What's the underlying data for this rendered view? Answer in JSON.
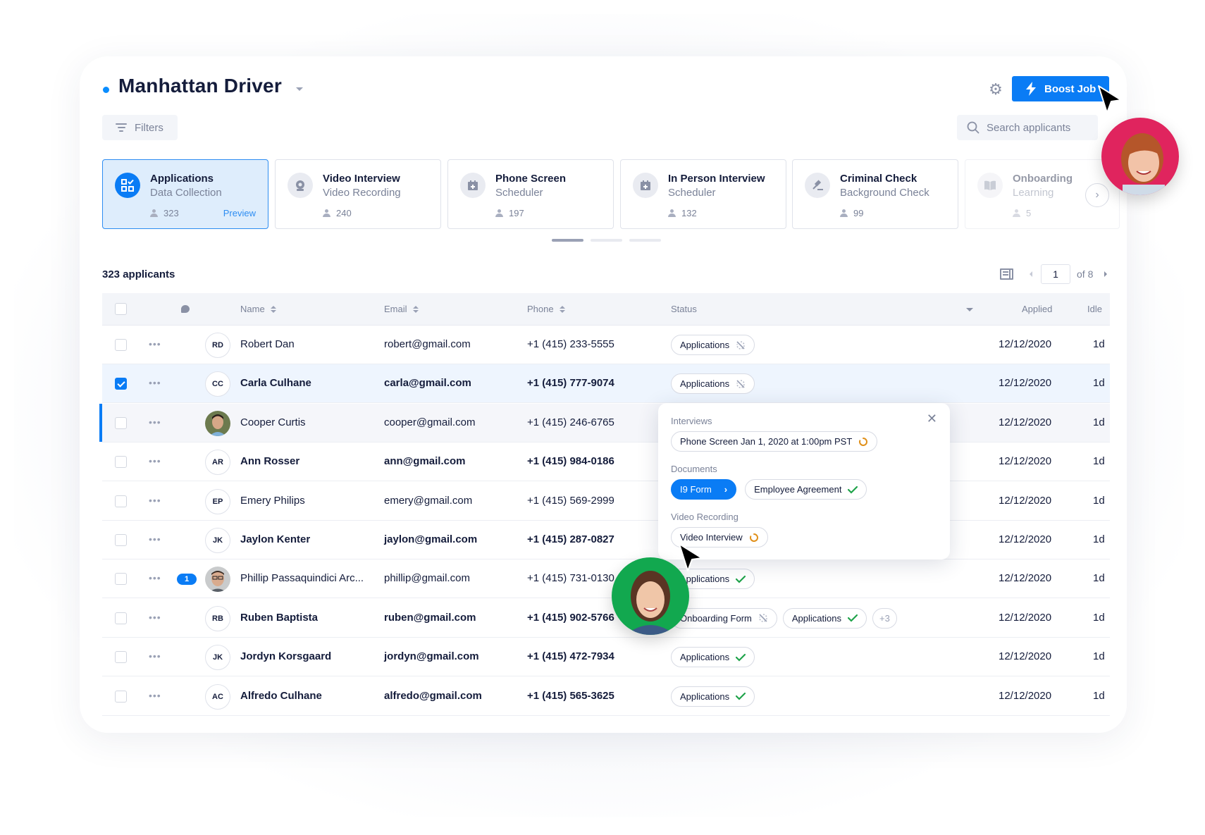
{
  "header": {
    "title": "Manhattan Driver",
    "filters_label": "Filters",
    "boost_label": "Boost Job",
    "search_placeholder": "Search applicants"
  },
  "stages": [
    {
      "name": "Applications",
      "sub": "Data Collection",
      "count": "323",
      "action": "Preview",
      "icon": "apps-check-icon",
      "state": "active"
    },
    {
      "name": "Video Interview",
      "sub": "Video Recording",
      "count": "240",
      "icon": "webcam-icon",
      "state": "normal"
    },
    {
      "name": "Phone Screen",
      "sub": "Scheduler",
      "count": "197",
      "icon": "calendar-plus-icon",
      "state": "normal"
    },
    {
      "name": "In Person Interview",
      "sub": "Scheduler",
      "count": "132",
      "icon": "calendar-plus-icon",
      "state": "normal"
    },
    {
      "name": "Criminal Check",
      "sub": "Background Check",
      "count": "99",
      "icon": "gavel-icon",
      "state": "normal"
    },
    {
      "name": "Onboarding",
      "sub": "Learning",
      "count": "5",
      "icon": "book-icon",
      "state": "faded"
    }
  ],
  "carousel": {
    "pages": 3,
    "current": 1
  },
  "list": {
    "count_label": "323 applicants",
    "page": "1",
    "of_label": "of 8"
  },
  "table": {
    "columns": {
      "name": "Name",
      "email": "Email",
      "phone": "Phone",
      "status": "Status",
      "applied": "Applied",
      "idle": "Idle"
    },
    "rows": [
      {
        "initials": "RD",
        "name": "Robert Dan",
        "email": "robert@gmail.com",
        "phone": "+1 (415) 233-5555",
        "tags": [
          {
            "label": "Applications",
            "icon": "unseen"
          }
        ],
        "applied": "12/12/2020",
        "idle": "1d",
        "bold": false,
        "checked": false
      },
      {
        "initials": "CC",
        "name": "Carla Culhane",
        "email": "carla@gmail.com",
        "phone": "+1 (415) 777-9074",
        "tags": [
          {
            "label": "Applications",
            "icon": "unseen"
          }
        ],
        "applied": "12/12/2020",
        "idle": "1d",
        "bold": true,
        "checked": true
      },
      {
        "initials": "",
        "photo": true,
        "name": "Cooper Curtis",
        "email": "cooper@gmail.com",
        "phone": "+1 (415) 246-6765",
        "tags": [],
        "applied": "12/12/2020",
        "idle": "1d",
        "bold": false,
        "checked": false,
        "hover": true
      },
      {
        "initials": "AR",
        "name": "Ann Rosser",
        "email": "ann@gmail.com",
        "phone": "+1 (415) 984-0186",
        "tags": [],
        "applied": "12/12/2020",
        "idle": "1d",
        "bold": true,
        "checked": false
      },
      {
        "initials": "EP",
        "name": "Emery Philips",
        "email": "emery@gmail.com",
        "phone": "+1 (415) 569-2999",
        "tags": [],
        "applied": "12/12/2020",
        "idle": "1d",
        "bold": false,
        "checked": false
      },
      {
        "initials": "JK",
        "name": "Jaylon Kenter",
        "email": "jaylon@gmail.com",
        "phone": "+1 (415) 287-0827",
        "tags": [],
        "applied": "12/12/2020",
        "idle": "1d",
        "bold": true,
        "checked": false
      },
      {
        "initials": "",
        "photo": true,
        "message_count": "1",
        "name": "Phillip Passaquindici Arc...",
        "email": "phillip@gmail.com",
        "phone": "+1 (415) 731-0130",
        "tags": [
          {
            "label": "Applications",
            "icon": "check"
          }
        ],
        "applied": "12/12/2020",
        "idle": "1d",
        "bold": false,
        "checked": false
      },
      {
        "initials": "RB",
        "name": "Ruben Baptista",
        "email": "ruben@gmail.com",
        "phone": "+1 (415) 902-5766",
        "tags": [
          {
            "label": "Onboarding Form",
            "icon": "unseen"
          },
          {
            "label": "Applications",
            "icon": "check"
          },
          {
            "label": "+3",
            "icon": ""
          }
        ],
        "applied": "12/12/2020",
        "idle": "1d",
        "bold": true,
        "checked": false
      },
      {
        "initials": "JK",
        "name": "Jordyn Korsgaard",
        "email": "jordyn@gmail.com",
        "phone": "+1 (415) 472-7934",
        "tags": [
          {
            "label": "Applications",
            "icon": "check"
          }
        ],
        "applied": "12/12/2020",
        "idle": "1d",
        "bold": true,
        "checked": false
      },
      {
        "initials": "AC",
        "name": "Alfredo Culhane",
        "email": "alfredo@gmail.com",
        "phone": "+1 (415) 565-3625",
        "tags": [
          {
            "label": "Applications",
            "icon": "check"
          }
        ],
        "applied": "12/12/2020",
        "idle": "1d",
        "bold": true,
        "checked": false
      }
    ]
  },
  "popover": {
    "interviews_label": "Interviews",
    "interview_tag": "Phone Screen Jan 1, 2020 at 1:00pm PST",
    "documents_label": "Documents",
    "doc_i9": "I9 Form",
    "doc_agreement": "Employee Agreement",
    "video_label": "Video Recording",
    "video_tag": "Video Interview"
  },
  "colors": {
    "accent": "#0a7cf5",
    "success": "#1fa34a",
    "pending": "#e0901a",
    "avatar_pink": "#e0245e",
    "avatar_green": "#12a84f"
  }
}
